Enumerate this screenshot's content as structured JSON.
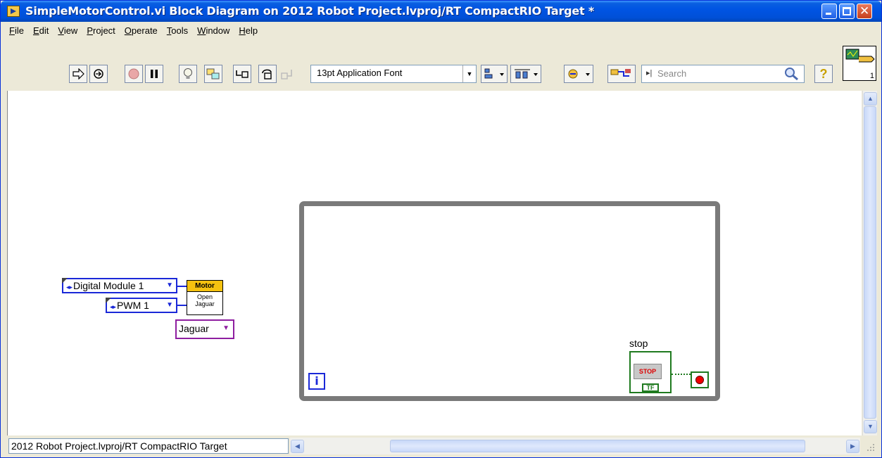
{
  "window": {
    "title": "SimpleMotorControl.vi Block Diagram on 2012 Robot Project.lvproj/RT CompactRIO Target *"
  },
  "menu": {
    "items": [
      {
        "label": "File",
        "u": "F",
        "rest": "ile"
      },
      {
        "label": "Edit",
        "u": "E",
        "rest": "dit"
      },
      {
        "label": "View",
        "u": "V",
        "rest": "iew"
      },
      {
        "label": "Project",
        "u": "P",
        "rest": "roject"
      },
      {
        "label": "Operate",
        "u": "O",
        "rest": "perate"
      },
      {
        "label": "Tools",
        "u": "T",
        "rest": "ools"
      },
      {
        "label": "Window",
        "u": "W",
        "rest": "indow"
      },
      {
        "label": "Help",
        "u": "H",
        "rest": "elp"
      }
    ]
  },
  "toolbar": {
    "font_select": "13pt Application Font",
    "search_placeholder": "Search",
    "help_glyph": "?"
  },
  "vi_icon": {
    "number": "1"
  },
  "diagram": {
    "iteration_label": "i",
    "digital_module": "Digital Module 1",
    "pwm": "PWM 1",
    "subvi_header": "Motor",
    "subvi_text_1": "Open",
    "subvi_text_2": "Jaguar",
    "jaguar": "Jaguar",
    "stop_label": "stop",
    "stop_button_text": "STOP",
    "tf_text": "TF"
  },
  "status": {
    "path": "2012 Robot Project.lvproj/RT CompactRIO Target"
  }
}
